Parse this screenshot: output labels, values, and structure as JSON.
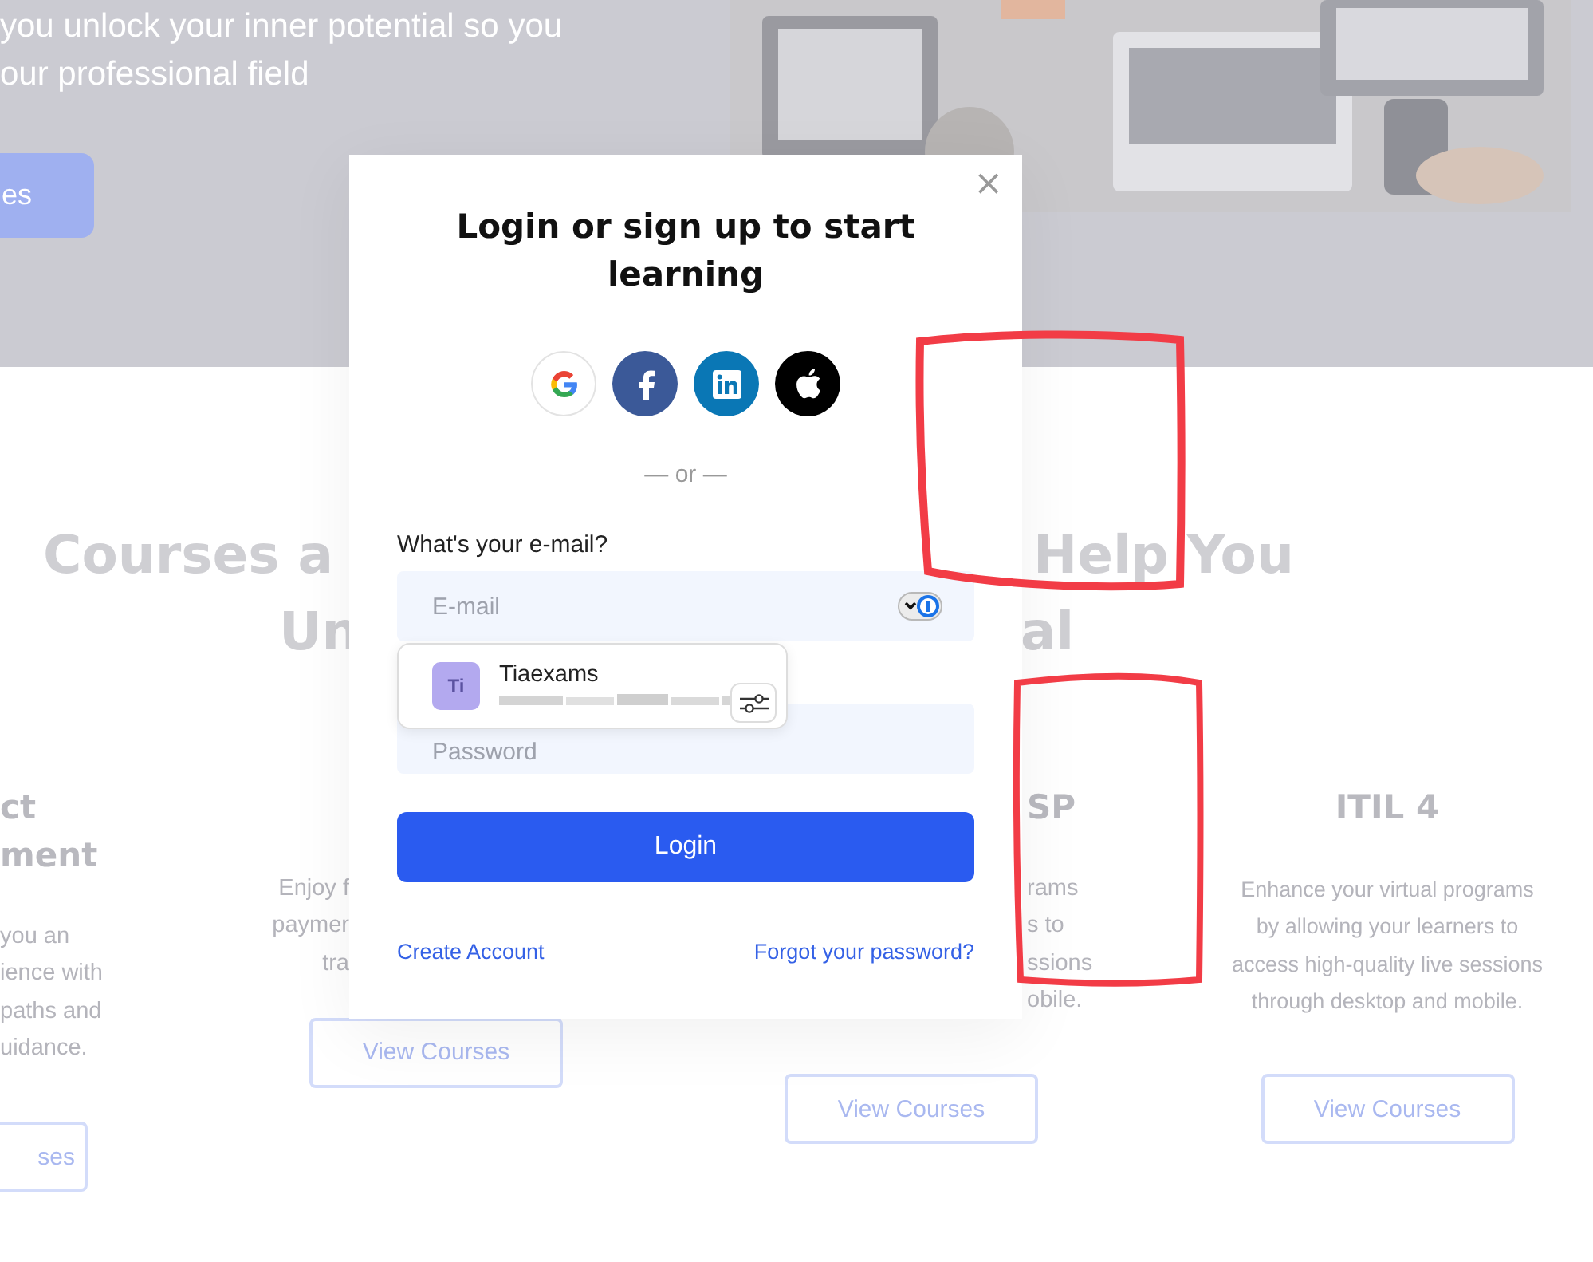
{
  "page": {
    "hero": {
      "lines": [
        "you unlock your inner potential so you",
        "our professional field"
      ],
      "button": "es",
      "picture": {
        "kind": "picture"
      }
    },
    "heading": {
      "left": [
        "Courses a",
        "Un"
      ],
      "right": [
        "Help You",
        "al"
      ]
    },
    "cards": [
      {
        "title": [
          "ct",
          "ment"
        ],
        "desc": [
          "you an",
          "ience with",
          "paths and",
          "uidance."
        ],
        "button": "ses"
      },
      {
        "desc": [
          "Enjoy f",
          "paymer",
          "tra"
        ],
        "button": "View Courses"
      },
      {
        "title": [
          "SP"
        ],
        "desc": [
          "rams",
          "s to",
          "ssions",
          "obile."
        ],
        "button": "View Courses"
      },
      {
        "title": [
          "ITIL 4"
        ],
        "desc": [
          "Enhance your virtual programs",
          "by allowing your learners to",
          "access high-quality live sessions",
          "through desktop and mobile."
        ],
        "button": "View Courses"
      }
    ]
  },
  "modal": {
    "close": "×",
    "title": "Login or sign up to start learning",
    "social": [
      {
        "kind": "google"
      },
      {
        "kind": "facebook"
      },
      {
        "kind": "linkedin"
      },
      {
        "kind": "apple"
      }
    ],
    "divider": "— or —",
    "email_label": "What's your e-mail?",
    "email": {
      "placeholder": "E-mail"
    },
    "password": {
      "placeholder": "Password"
    },
    "login": "Login",
    "create_account": "Create Account",
    "forgot": "Forgot your password?"
  },
  "autofill": {
    "avatar": "Ti",
    "name": "Tiaexams"
  }
}
